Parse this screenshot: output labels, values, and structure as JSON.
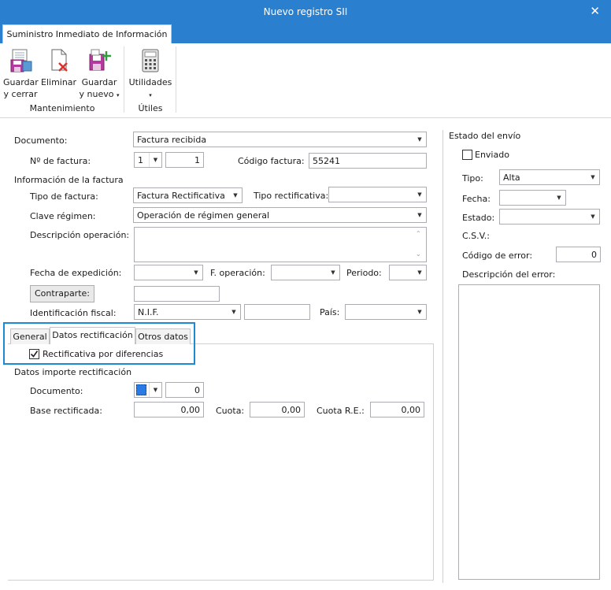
{
  "window": {
    "title": "Nuevo registro SII"
  },
  "ribbon": {
    "tab": "Suministro Inmediato de Información",
    "buttons": {
      "guardar_cerrar": [
        "Guardar",
        "y cerrar"
      ],
      "eliminar": "Eliminar",
      "guardar_nuevo": [
        "Guardar",
        "y nuevo"
      ],
      "utilidades": "Utilidades"
    },
    "groups": {
      "mantenimiento": "Mantenimiento",
      "utiles": "Útiles"
    }
  },
  "form": {
    "documento_label": "Documento:",
    "documento_value": "Factura recibida",
    "nfactura_label": "Nº de factura:",
    "nfactura_serie": "1",
    "nfactura_num": "1",
    "codigo_label": "Código factura:",
    "codigo_value": "55241",
    "info_section": "Información de la factura",
    "tipo_factura_label": "Tipo de factura:",
    "tipo_factura_value": "Factura Rectificativa",
    "tipo_rect_label": "Tipo rectificativa:",
    "tipo_rect_value": "",
    "clave_label": "Clave régimen:",
    "clave_value": "Operación de régimen general",
    "descripcion_label": "Descripción operación:",
    "fecha_exp_label": "Fecha de expedición:",
    "f_operacion_label": "F. operación:",
    "periodo_label": "Periodo:",
    "contraparte_button": "Contraparte:",
    "ident_label": "Identificación fiscal:",
    "ident_type": "N.I.F.",
    "pais_label": "País:"
  },
  "subtabs": {
    "items": [
      "General",
      "Datos rectificación",
      "Otros datos"
    ],
    "active": "Datos rectificación"
  },
  "rect": {
    "checkbox_label": "Rectificativa por diferencias",
    "checked": true,
    "importe_section": "Datos importe rectificación",
    "documento_label": "Documento:",
    "documento_value": "0",
    "base_label": "Base rectificada:",
    "base_value": "0,00",
    "cuota_label": "Cuota:",
    "cuota_value": "0,00",
    "cuota_re_label": "Cuota R.E.:",
    "cuota_re_value": "0,00"
  },
  "envio": {
    "section": "Estado del envío",
    "enviado_label": "Enviado",
    "enviado_checked": false,
    "tipo_label": "Tipo:",
    "tipo_value": "Alta",
    "fecha_label": "Fecha:",
    "estado_label": "Estado:",
    "csv_label": "C.S.V.:",
    "codigo_error_label": "Código de error:",
    "codigo_error_value": "0",
    "desc_error_label": "Descripción del error:"
  },
  "colors": {
    "titlebar": "#2b7fcf",
    "highlight_border": "#1b8ad3"
  }
}
